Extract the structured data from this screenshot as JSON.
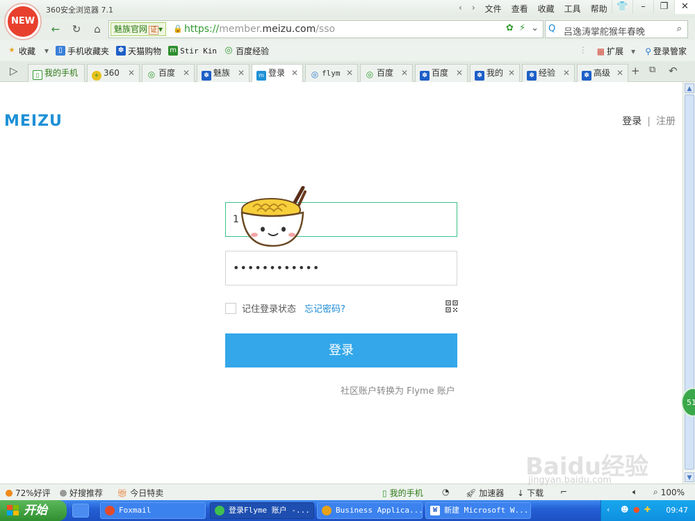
{
  "titlebar": {
    "logo_text": "NEW",
    "app_title": "360安全浏览器 7.1",
    "menu": [
      "文件",
      "查看",
      "收藏",
      "工具",
      "帮助"
    ]
  },
  "navbar": {
    "site_badge": "魅族官网",
    "cert_label": "证",
    "url_scheme": "https://",
    "url_pre": "member.",
    "url_host": "meizu.com",
    "url_path": "/sso",
    "search_text": "吕逸涛掌舵猴年春晚"
  },
  "bookmarks": {
    "items": [
      "收藏",
      "手机收藏夹",
      "天猫购物",
      "Stir Kin",
      "百度经验"
    ],
    "right": [
      "扩展",
      "登录管家"
    ]
  },
  "tabs": [
    {
      "label": "我的手机"
    },
    {
      "label": "360"
    },
    {
      "label": "百度"
    },
    {
      "label": "魅族"
    },
    {
      "label": "登录"
    },
    {
      "label": "flym"
    },
    {
      "label": "百度"
    },
    {
      "label": "百度"
    },
    {
      "label": "我的"
    },
    {
      "label": "经验"
    },
    {
      "label": "高级"
    }
  ],
  "page": {
    "logo": "MEIZU",
    "login_link": "登录",
    "separator": "|",
    "register_link": "注册",
    "account_value": "1",
    "password_value": "••••••••••••",
    "remember_label": "记住登录状态",
    "forgot_label": "忘记密码?",
    "login_button": "登录",
    "convert_text": "社区账户转换为 Flyme 账户"
  },
  "side_badge": "51",
  "statusbar": {
    "rating": "72%好评",
    "recommend": "好搜推荐",
    "deals": "今日特卖",
    "my_phone": "我的手机",
    "accelerator": "加速器",
    "download": "下载",
    "zoom": "100%"
  },
  "taskbar": {
    "start": "开始",
    "tasks": [
      "Foxmail",
      "登录Flyme 账户 -...",
      "Business Applica...",
      "新建 Microsoft W..."
    ],
    "time": "09:47"
  },
  "watermark": {
    "brand": "Baidu经验",
    "url": "jingyan.baidu.com"
  },
  "colors": {
    "accent": "#33a7ea",
    "meizu_blue": "#1e91d6",
    "focus_green": "#37c48a",
    "browser_green": "#2f9a2f"
  }
}
